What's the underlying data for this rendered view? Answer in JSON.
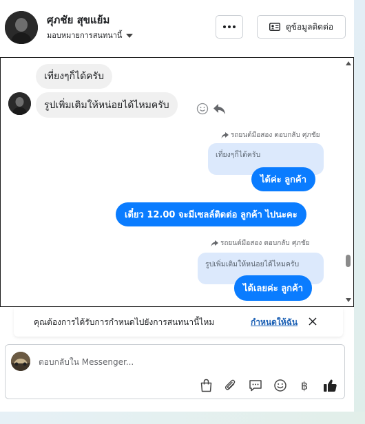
{
  "header": {
    "contact_name": "ศุภชัย สุขแย้ม",
    "assign_label": "มอบหมายการสนทนานี้",
    "more_label": "…",
    "contact_button_label": "ดูข้อมูลติดต่อ"
  },
  "messages": {
    "incoming_1": "เที่ยงๆก็ได้ครับ",
    "incoming_2": "รูปเพิ่มเติมให้หน่อยได้ไหมครับ",
    "reply_meta_1": "รถยนต์มือสอง ตอบกลับ ศุภชัย",
    "quote_1": "เที่ยงๆก็ได้ครับ",
    "outgoing_1": "ได้ค่ะ  ลูกค้า",
    "outgoing_2": "เดี๋ยว 12.00 จะมีเซลล์ติดต่อ ลูกค้า ไปนะคะ",
    "reply_meta_2": "รถยนต์มือสอง ตอบกลับ ศุภชัย",
    "quote_2": "รูปเพิ่มเติมให้หน่อยได้ไหมครับ",
    "outgoing_3": "ได้เลยค่ะ  ลูกค้า"
  },
  "notice": {
    "text": "คุณต้องการได้รับการกำหนดไปยังการสนทนานี้ไหม",
    "link": "กำหนดให้ฉัน"
  },
  "composer": {
    "placeholder": "ตอบกลับใน Messenger...",
    "currency_symbol": "฿"
  },
  "colors": {
    "accent": "#0a7cff",
    "quote_bg": "#dce9fc",
    "incoming_bg": "#f0f0f0",
    "link": "#1a5fb4"
  }
}
